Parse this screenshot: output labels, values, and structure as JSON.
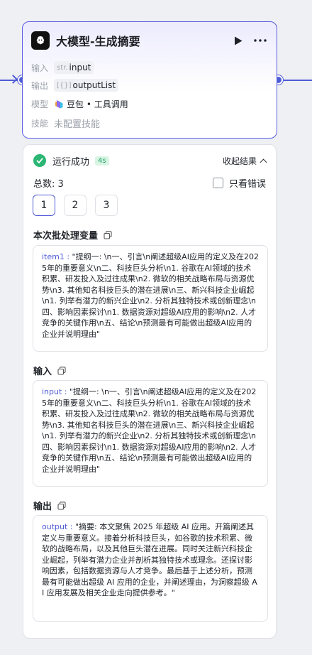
{
  "node": {
    "title": "大模型-生成摘要",
    "rows": {
      "input_label": "输入",
      "input_type": "str.",
      "input_value": "input",
      "output_label": "输出",
      "output_type": "[{}]",
      "output_value": "outputList",
      "model_label": "模型",
      "model_value": "豆包 • 工具调用",
      "skill_label": "技能",
      "skill_value": "未配置技能"
    }
  },
  "result": {
    "status": "运行成功",
    "time": "4s",
    "collapse_label": "收起结果",
    "total": "总数: 3",
    "only_errors": "只看错误",
    "pages": [
      "1",
      "2",
      "3"
    ],
    "batch_title": "本次批处理变量",
    "batch_key": "item1 :",
    "batch_value": " \"提纲一: \\n一、引言\\n阐述超级AI应用的定义及在2025年的重要意义\\n二、科技巨头分析\\n1. 谷歌在AI领域的技术积累、研发投入及过往成果\\n2. 微软的相关战略布局与资源优势\\n3. 其他知名科技巨头的潜在进展\\n三、新兴科技企业崛起\\n1. 列举有潜力的新兴企业\\n2. 分析其独特技术或创新理念\\n四、影响因素探讨\\n1. 数据资源对超级AI应用的影响\\n2. 人才竞争的关键作用\\n五、结论\\n预测最有可能做出超级AI应用的企业并说明理由\"",
    "input_title": "输入",
    "input_key": "input :",
    "input_value": " \"提纲一: \\n一、引言\\n阐述超级AI应用的定义及在2025年的重要意义\\n二、科技巨头分析\\n1. 谷歌在AI领域的技术积累、研发投入及过往成果\\n2. 微软的相关战略布局与资源优势\\n3. 其他知名科技巨头的潜在进展\\n三、新兴科技企业崛起\\n1. 列举有潜力的新兴企业\\n2. 分析其独特技术或创新理念\\n四、影响因素探讨\\n1. 数据资源对超级AI应用的影响\\n2. 人才竞争的关键作用\\n五、结论\\n预测最有可能做出超级AI应用的企业并说明理由\"",
    "output_title": "输出",
    "output_key": "output :",
    "output_value": " \"摘要: 本文聚焦 2025 年超级 AI 应用。开篇阐述其定义与重要意义。接着分析科技巨头，如谷歌的技术积累、微软的战略布局，以及其他巨头潜在进展。同时关注新兴科技企业崛起，列举有潜力企业并剖析其独特技术或理念。还探讨影响因素，包括数据资源与人才竞争。最后基于上述分析，预测最有可能做出超级 AI 应用的企业，并阐述理由，为洞察超级 AI 应用发展及相关企业走向提供参考。\""
  },
  "colors": {
    "accent": "#4e5bd6",
    "success": "#2bb673"
  }
}
